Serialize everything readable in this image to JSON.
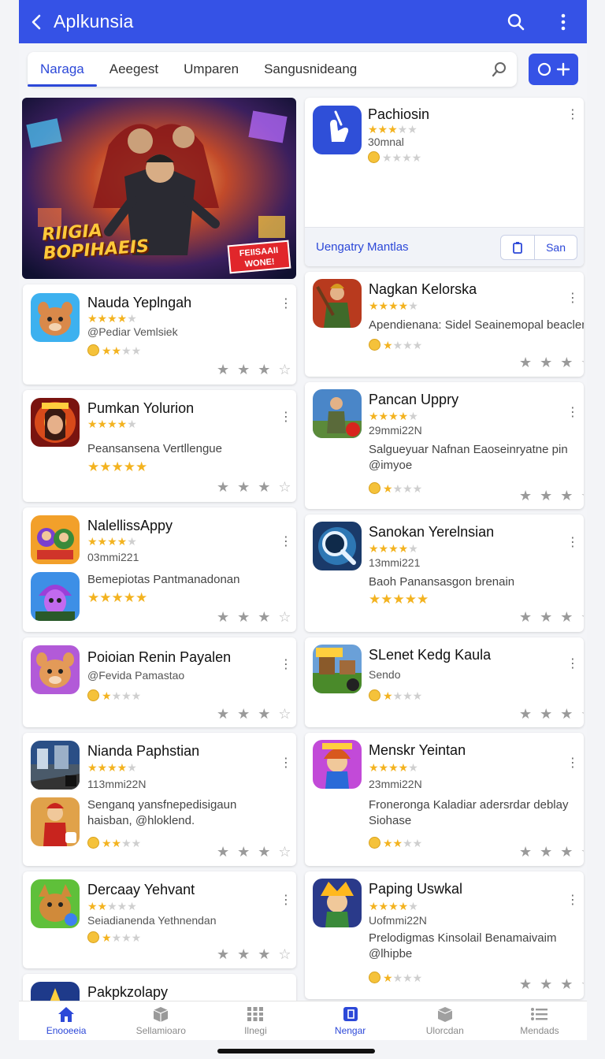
{
  "header": {
    "title": "Aplkunsia"
  },
  "tabs": [
    "Naraga",
    "Aeegest",
    "Umparen",
    "Sangusnideang"
  ],
  "colors": {
    "primary": "#3552e6",
    "star": "#f3b320",
    "background": "#f4f5f8"
  },
  "featured": {
    "title": "Pachiosin",
    "rating": 3,
    "subtitle": "30mnal",
    "footer_label": "Uengatry Mantlas",
    "footer_button": "San",
    "banner": {
      "title": "RIIGIA\nBOPIHAEIS",
      "badge": "FEIISAAII\nWONE!"
    }
  },
  "left_cards": [
    {
      "title": "Nauda Yeplngah",
      "rating": 4,
      "subtitle": "@Pediar Vemlsiek",
      "mini_rating": 2
    },
    {
      "title": "Pumkan Yolurion",
      "rating": 4,
      "desc": "Peansansena Vertllengue",
      "desc_rating": 5
    },
    {
      "title": "NalellissAppy",
      "rating": 4,
      "subtitle": "03mmi221",
      "desc": "Bemepiotas Pantmanadonan",
      "desc_rating": 5
    },
    {
      "title": "Poioian Renin Payalen",
      "subtitle": "@Fevida Pamastao",
      "mini_rating": 1
    },
    {
      "title": "Nianda Paphstian",
      "rating": 4,
      "subtitle": "113mmi22N",
      "desc": "Senganq yansfnepedisigaun haisban, @hloklend.",
      "mini_rating": 2
    },
    {
      "title": "Dercaay Yehvant",
      "rating": 2,
      "subtitle": "Seiadianenda Yethnendan",
      "mini_rating": 1
    },
    {
      "title": "Pakpkzolapy"
    }
  ],
  "right_cards": [
    {
      "title": "Nagkan Kelorska",
      "rating": 4,
      "subtitle": "Apendienana: Sidel Seainemopal beaclen",
      "mini_rating": 1
    },
    {
      "title": "Pancan Uppry",
      "rating": 4,
      "subtitle": "29mmi22N",
      "desc": "Salgueyuar Nafnan Eaoseinryatne pin @imyoe",
      "mini_rating": 1
    },
    {
      "title": "Sanokan Yerelnsian",
      "rating": 4,
      "subtitle": "13mmi221",
      "desc": "Baoh Panansasgon brenain",
      "desc_rating": 5
    },
    {
      "title": "SLenet Kedg Kaula",
      "subtitle": "Sendo",
      "mini_rating": 1
    },
    {
      "title": "Menskr Yeintan",
      "rating": 4,
      "subtitle": "23mmi22N",
      "desc": "Froneronga Kaladiar adersrdar deblay Siohase",
      "mini_rating": 2
    },
    {
      "title": "Paping Uswkal",
      "rating": 4,
      "subtitle": "Uofmmi22N",
      "desc": "Prelodigmas Kinsolail Benamaivaim @lhipbe",
      "mini_rating": 1
    }
  ],
  "bottom_nav": [
    {
      "label": "Enooeeia",
      "icon": "home-icon",
      "active": false
    },
    {
      "label": "Sellamioaro",
      "icon": "box-icon",
      "active": false
    },
    {
      "label": "Ilnegi",
      "icon": "grid-icon",
      "active": false
    },
    {
      "label": "Nengar",
      "icon": "apps-icon",
      "active": true
    },
    {
      "label": "Ulorcdan",
      "icon": "package-icon",
      "active": false
    },
    {
      "label": "Mendads",
      "icon": "list-icon",
      "active": false
    }
  ]
}
